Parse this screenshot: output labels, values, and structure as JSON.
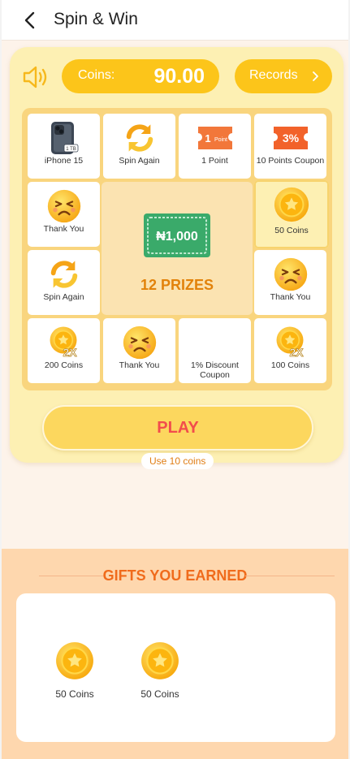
{
  "header": {
    "title": "Spin & Win"
  },
  "wallet": {
    "coins_label": "Coins:",
    "coins_value": "90.00",
    "records_label": "Records"
  },
  "board": {
    "cells": [
      {
        "label": "iPhone 15",
        "icon": "phone-icon",
        "badge": "1 TB"
      },
      {
        "label": "Spin Again",
        "icon": "refresh-icon"
      },
      {
        "label": "1 Point",
        "icon": "point-ticket-icon",
        "badge": "1",
        "badge_suffix": "Point"
      },
      {
        "label": "10 Points Coupon",
        "icon": "coupon-icon",
        "badge": "3%"
      },
      {
        "label": "Thank You",
        "icon": "sad-face-icon"
      },
      {
        "label": "50 Coins",
        "icon": "coin-icon"
      },
      {
        "label": "Spin Again",
        "icon": "refresh-icon"
      },
      {
        "label": "Thank You",
        "icon": "sad-face-icon"
      },
      {
        "label": "200 Coins",
        "icon": "coin-icon",
        "badge": "2X"
      },
      {
        "label": "Thank You",
        "icon": "sad-face-icon"
      },
      {
        "label": "1% Discount Coupon",
        "icon": "blank"
      },
      {
        "label": "100 Coins",
        "icon": "coin-icon",
        "badge": "2X"
      }
    ],
    "center": {
      "banknote": "₦1,000",
      "prizes_label": "12 PRIZES"
    },
    "active_cell": "50 Coins"
  },
  "play": {
    "label": "PLAY",
    "cost": "Use 10 coins"
  },
  "gifts": {
    "title": "GIFTS YOU EARNED",
    "items": [
      {
        "label": "50 Coins",
        "icon": "coin-icon"
      },
      {
        "label": "50 Coins",
        "icon": "coin-icon"
      }
    ]
  },
  "colors": {
    "accent": "#fcc51a",
    "card_bg": "#fdf0b3",
    "play_text": "#f24c4c",
    "gifts_title": "#f06b1c",
    "banknote": "#3aaa6a"
  }
}
